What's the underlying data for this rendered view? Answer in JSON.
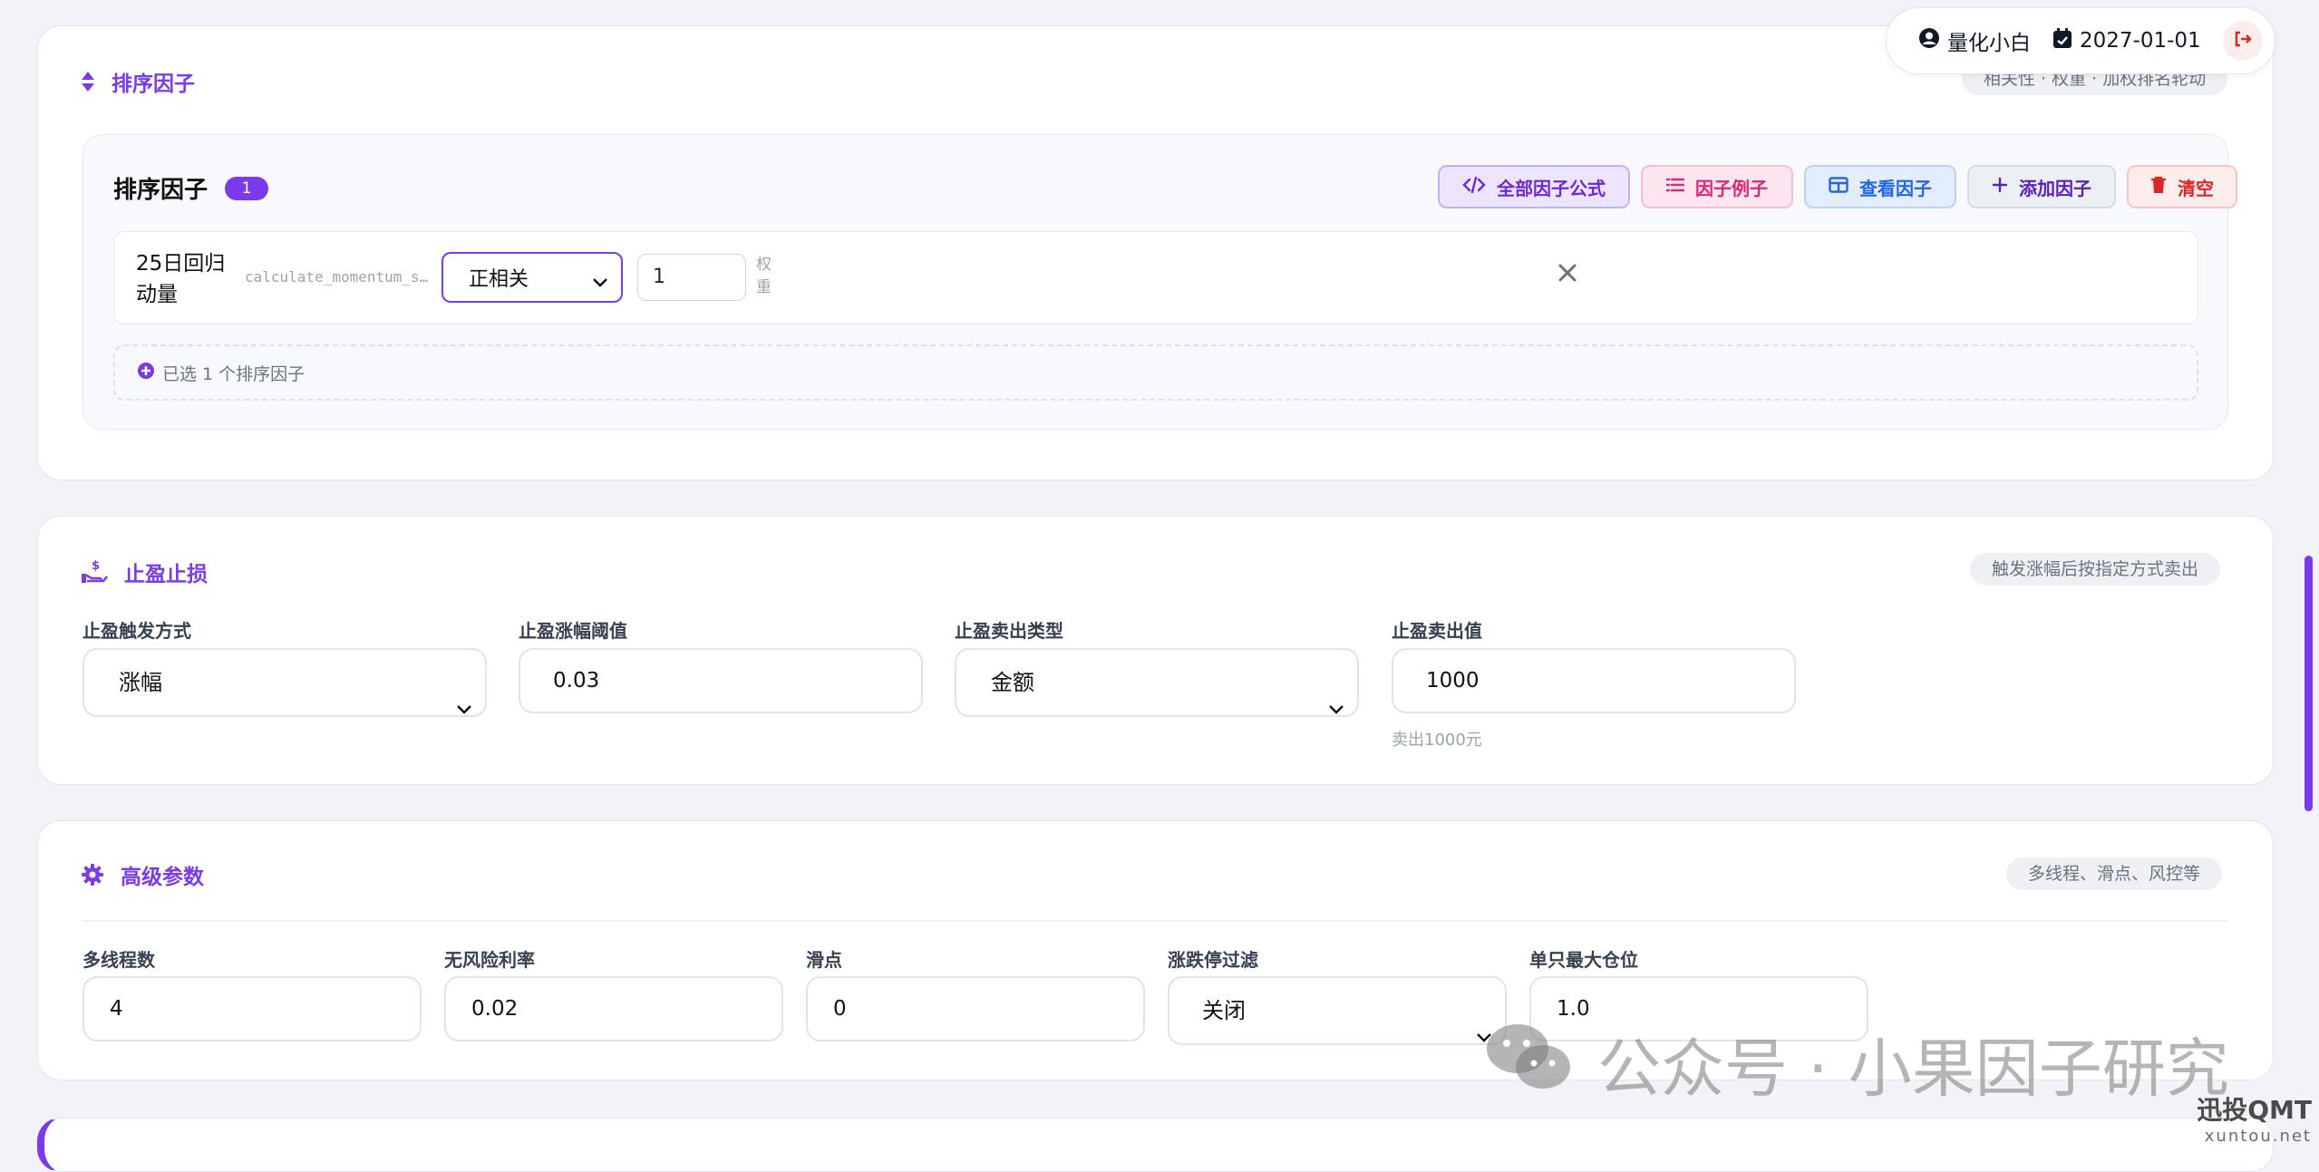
{
  "user": {
    "name": "量化小白",
    "date": "2027-01-01"
  },
  "ranking": {
    "title": "排序因子",
    "tag": "相关性 · 权重 · 加权排名轮动",
    "panel_title": "排序因子",
    "count": "1",
    "toolbar": {
      "formula": "全部因子公式",
      "example": "因子例子",
      "view": "查看因子",
      "add": "添加因子",
      "clear": "清空"
    },
    "factors": [
      {
        "name": "25日回归动量",
        "func": "calculate_momentum_s…",
        "direction": "正相关",
        "weight": "1",
        "weight_label": "权重"
      }
    ],
    "selected_note": "已选 1 个排序因子"
  },
  "take_profit": {
    "title": "止盈止损",
    "tag": "触发涨幅后按指定方式卖出",
    "fields": {
      "trigger_label": "止盈触发方式",
      "trigger_value": "涨幅",
      "threshold_label": "止盈涨幅阈值",
      "threshold_value": "0.03",
      "sell_type_label": "止盈卖出类型",
      "sell_type_value": "金额",
      "sell_value_label": "止盈卖出值",
      "sell_value": "1000",
      "sell_value_hint": "卖出1000元"
    }
  },
  "advanced": {
    "title": "高级参数",
    "tag": "多线程、滑点、风控等",
    "fields": {
      "threads_label": "多线程数",
      "threads_value": "4",
      "rf_label": "无风险利率",
      "rf_value": "0.02",
      "slippage_label": "滑点",
      "slippage_value": "0",
      "limit_filter_label": "涨跌停过滤",
      "limit_filter_value": "关闭",
      "max_pos_label": "单只最大仓位",
      "max_pos_value": "1.0"
    }
  },
  "watermark": {
    "text": "公众号 · 小果因子研究",
    "brand": "迅投QMT",
    "brand_url": "xuntou.net"
  },
  "colors": {
    "accent": "#7c3aed",
    "danger": "#dc2626",
    "pink": "#db2777",
    "blue": "#2563eb"
  }
}
